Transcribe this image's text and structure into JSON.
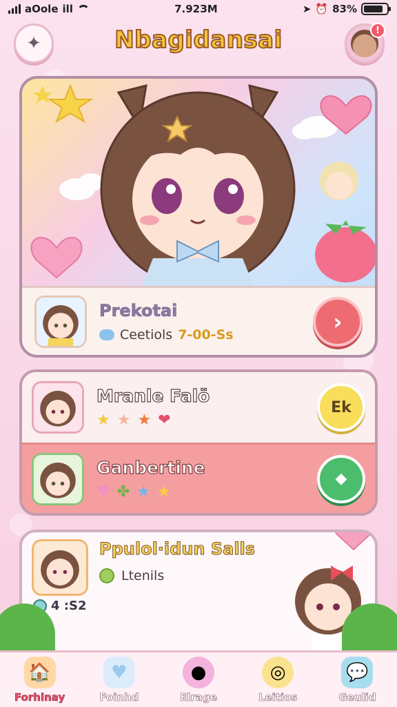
{
  "status_bar": {
    "carrier": "аOole",
    "signal_text": "ill",
    "time": "7.92ЗМ",
    "battery_percent": "83%"
  },
  "header": {
    "title": "Nbagidansai"
  },
  "featured": {
    "title": "Prekotai",
    "meta_label": "Ceetiols",
    "meta_time": "7-00-Ss"
  },
  "list": {
    "rows": [
      {
        "title": "Mranle Falö",
        "badge": "Ek"
      },
      {
        "title": "Ganbertine",
        "badge": ""
      }
    ]
  },
  "third": {
    "title": "Ppulol·idun Salls",
    "meta_label": "Ltenils",
    "count": "4 :S2"
  },
  "nav": {
    "items": [
      {
        "label": "Forhinay"
      },
      {
        "label": "Foinhd"
      },
      {
        "label": "Elrage"
      },
      {
        "label": "Leitios"
      },
      {
        "label": "Geulid"
      }
    ]
  }
}
